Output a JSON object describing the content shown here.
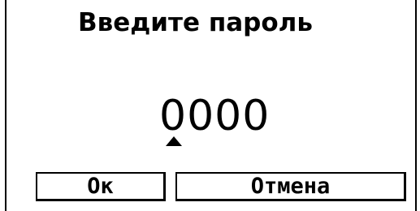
{
  "dialog": {
    "title": "Введите пароль",
    "password_value": "0000",
    "cursor_position": 1,
    "cursor_marker_icon": "triangle-up-icon"
  },
  "buttons": {
    "ok_label": "Ок",
    "cancel_label": "Отмена"
  }
}
